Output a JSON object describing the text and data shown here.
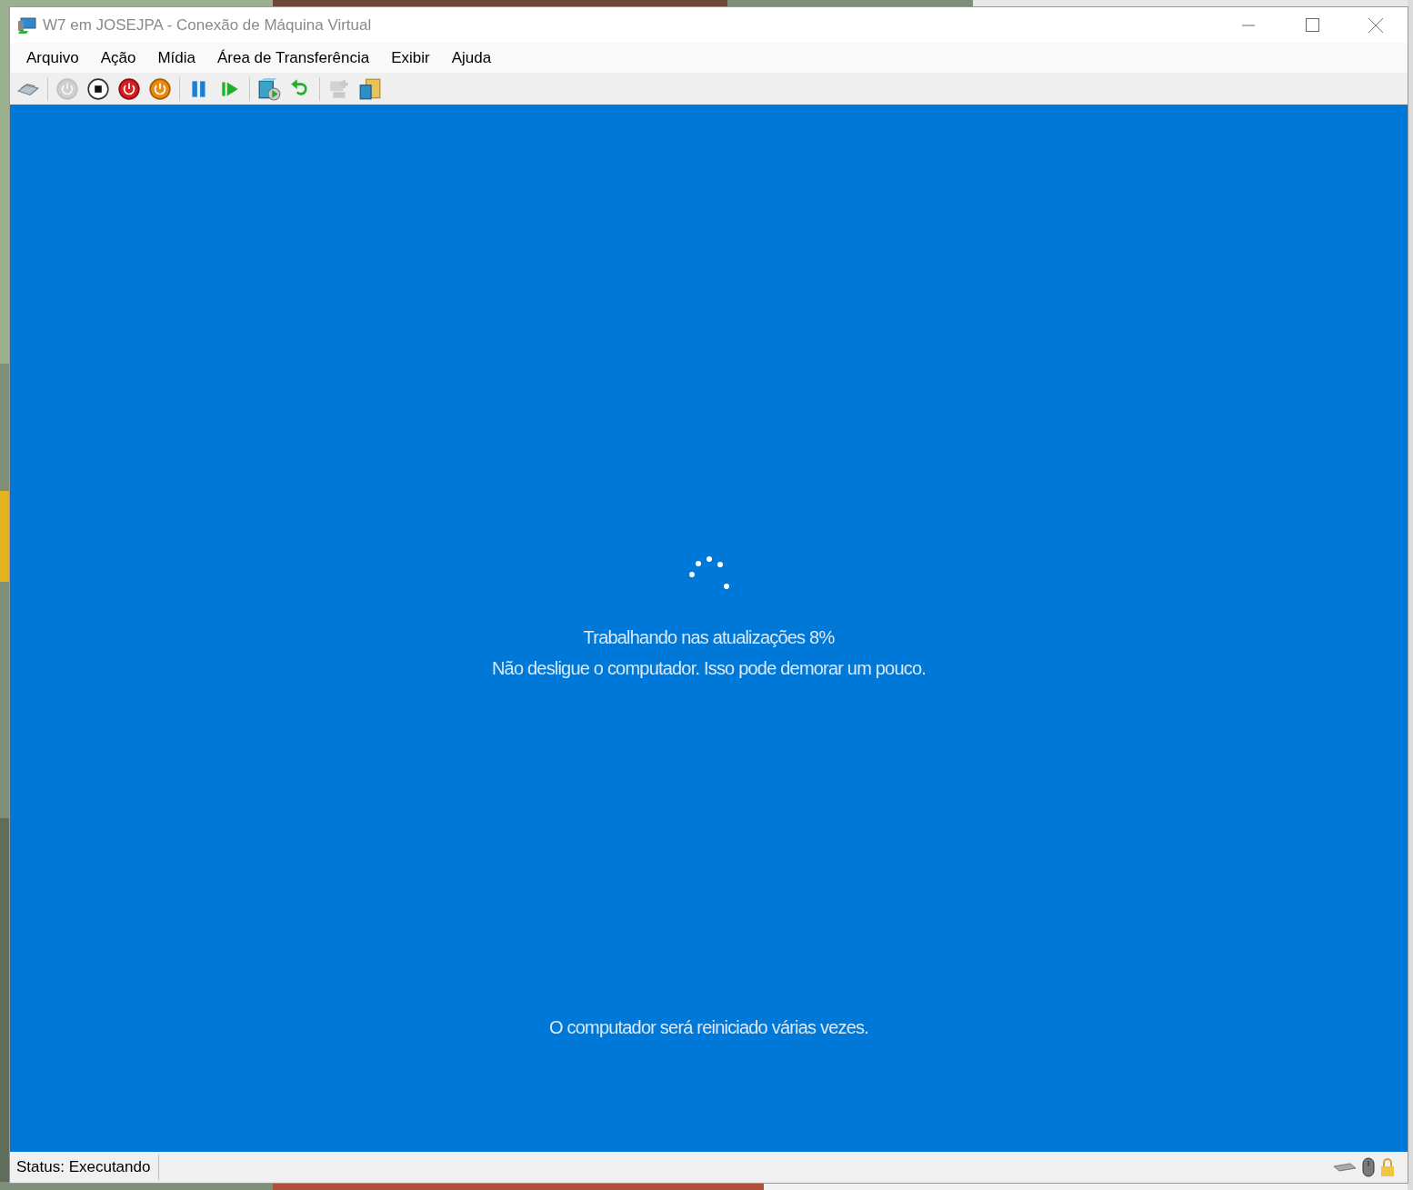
{
  "window": {
    "title": "W7 em JOSEJPA - Conexão de Máquina Virtual"
  },
  "menu": [
    "Arquivo",
    "Ação",
    "Mídia",
    "Área de Transferência",
    "Exibir",
    "Ajuda"
  ],
  "toolbar": [
    {
      "kind": "ctrl-alt-del",
      "disabled": false
    },
    {
      "kind": "separator"
    },
    {
      "kind": "start",
      "disabled": true
    },
    {
      "kind": "turn-off",
      "disabled": false
    },
    {
      "kind": "shut-down",
      "disabled": false
    },
    {
      "kind": "save",
      "disabled": false
    },
    {
      "kind": "separator"
    },
    {
      "kind": "pause",
      "disabled": false
    },
    {
      "kind": "reset",
      "disabled": false
    },
    {
      "kind": "separator"
    },
    {
      "kind": "checkpoint",
      "disabled": false
    },
    {
      "kind": "revert",
      "disabled": false
    },
    {
      "kind": "separator"
    },
    {
      "kind": "enhanced-session",
      "disabled": true
    },
    {
      "kind": "share",
      "disabled": false
    }
  ],
  "screen": {
    "progress_line": "Trabalhando nas atualizações  8%",
    "warning_line": "Não desligue o computador. Isso pode demorar um pouco.",
    "footer_line": "O computador será reiniciado várias vezes."
  },
  "status_bar": {
    "status": "Status: Executando"
  }
}
